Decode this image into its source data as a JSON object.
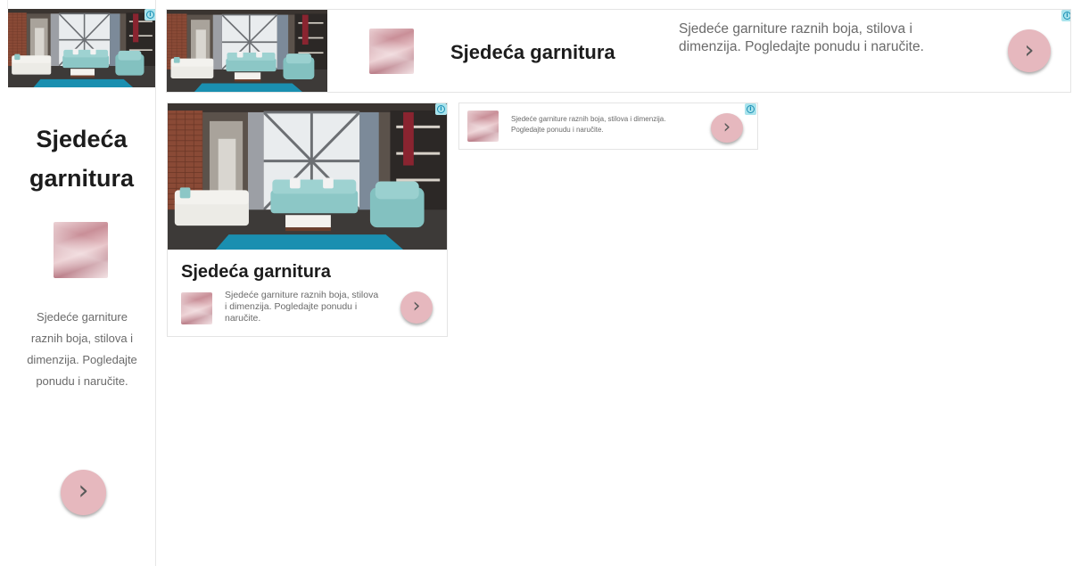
{
  "ads": {
    "tall": {
      "title": "Sjedeća garnitura",
      "description": "Sjedeće garniture raznih boja, stilova i dimenzija. Pogledajte ponudu i naručite.",
      "cta": "›"
    },
    "leaderboard": {
      "title": "Sjedeća garnitura",
      "description": "Sjedeće garniture raznih boja, stilova i dimenzija. Pogledajte ponudu i naručite.",
      "cta": "›"
    },
    "rectangle": {
      "title": "Sjedeća garnitura",
      "description": "Sjedeće garniture raznih boja, stilova i dimenzija. Pogledajte ponudu i naručite.",
      "cta": "›"
    },
    "banner": {
      "description": "Sjedeće garniture raznih boja, stilova i dimenzija. Pogledajte ponudu i naručite.",
      "cta": "›"
    },
    "adchoices_glyph": "i"
  },
  "colors": {
    "cta_background": "#e6b8be",
    "adchoices_background": "#a9e3ec",
    "sofa_teal": "#8cc7c6",
    "rug_blue": "#1a8fb0"
  },
  "icons": [
    "adchoices-icon",
    "chevron-right-icon"
  ]
}
